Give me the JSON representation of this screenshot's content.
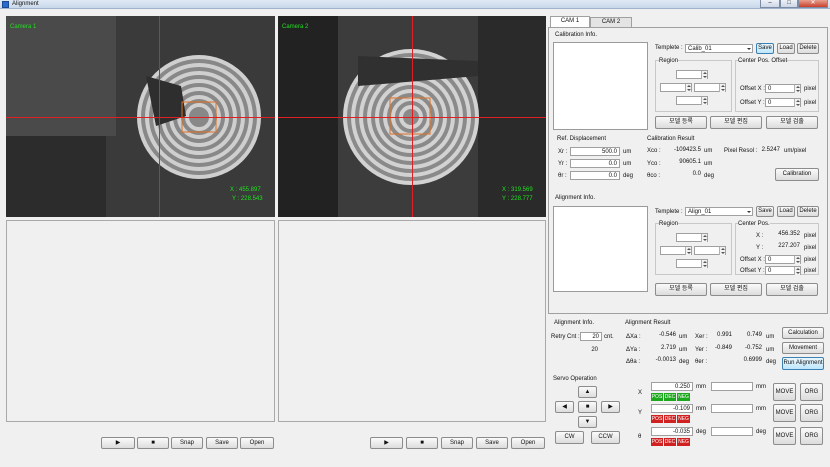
{
  "window": {
    "title": "Alignment",
    "min": "–",
    "max": "□",
    "close": "✕"
  },
  "cam1": {
    "label": "Camera 1",
    "x": "X : 455.897",
    "y": "Y : 228.543"
  },
  "cam2": {
    "label": "Camera 2",
    "x": "X : 319.569",
    "y": "Y : 228.777"
  },
  "ctrl1": {
    "play": "▶",
    "stop": "■",
    "snap": "Snap",
    "save": "Save",
    "open": "Open"
  },
  "ctrl2": {
    "play": "▶",
    "stop": "■",
    "snap": "Snap",
    "save": "Save",
    "open": "Open"
  },
  "tabs": [
    "CAM 1",
    "CAM 2"
  ],
  "calib": {
    "title": "Calibration Info.",
    "template_label": "Templete :",
    "template_value": "Calib_01",
    "save": "Save",
    "load": "Load",
    "delete": "Delete",
    "region": "Region",
    "center_offset": "Center Pos. Offset",
    "offx_label": "Offset X :",
    "offx": "0",
    "offy_label": "Offset Y :",
    "offy": "0",
    "pixel": "pixel",
    "reg_btn": "모델 등록",
    "edit_btn": "모델 편집",
    "check_btn": "모델 검출"
  },
  "ref": {
    "title": "Ref. Displacement",
    "xr_label": "Xr :",
    "xr": "500.0",
    "yr_label": "Yr :",
    "yr": "0.0",
    "tr_label": "θr :",
    "tr": "0.0",
    "um": "um",
    "deg": "deg"
  },
  "calres": {
    "title": "Calibration Result",
    "xco_label": "Xco :",
    "xco": "-109423.5",
    "yco_label": "Yco :",
    "yco": "90605.1",
    "tco_label": "θco :",
    "tco": "0.0",
    "um": "um",
    "deg": "deg",
    "pixres_label": "Pixel Resol :",
    "pixres": "2.5247",
    "pixres_unit": "um/pixel",
    "calibration_btn": "Calibration"
  },
  "align": {
    "title": "Alignment Info.",
    "template_label": "Templete :",
    "template_value": "Align_01",
    "save": "Save",
    "load": "Load",
    "delete": "Delete",
    "region": "Region",
    "center": "Center Pos.",
    "x_label": "X :",
    "x": "456.352",
    "y_label": "Y :",
    "y": "227.207",
    "offx_label": "Offset X :",
    "offx": "0",
    "offy_label": "Offset Y :",
    "offy": "0",
    "pixel": "pixel",
    "reg_btn": "모델 등록",
    "edit_btn": "모델 편집",
    "check_btn": "모델 검출"
  },
  "aligninfo": {
    "title": "Alignment Info.",
    "retry_label": "Retry Cnt :",
    "retry": "20",
    "cnt": "cnt.",
    "count": "20"
  },
  "alignres": {
    "title": "Alignment Result",
    "dxa_label": "ΔXa :",
    "dxa": "-0.546",
    "dya_label": "ΔYa :",
    "dya": "2.719",
    "dta_label": "Δθa :",
    "dta": "-0.0013",
    "xer_label": "Xer :",
    "xer1": "0.991",
    "xer2": "0.749",
    "yer_label": "Yer :",
    "yer1": "-0.849",
    "yer2": "-0.752",
    "ter_label": "θer :",
    "ter": "0.6999",
    "um": "um",
    "deg": "deg"
  },
  "actions": {
    "calculation": "Calculation",
    "movement": "Movement",
    "run": "Run Alignment"
  },
  "servo": {
    "title": "Servo Operation",
    "up": "▲",
    "down": "▼",
    "left": "◀",
    "right": "▶",
    "stop": "■",
    "cw": "CW",
    "ccw": "CCW",
    "x_label": "X",
    "x_value": "0.250",
    "x_unit": "mm",
    "y_label": "Y",
    "y_value": "-0.109",
    "y_unit": "mm",
    "t_label": "θ",
    "t_value": "-0.035",
    "t_unit": "deg",
    "pos": "POS",
    "dec": "DEC",
    "neg": "NEG",
    "move": "MOVE",
    "org": "ORG"
  }
}
